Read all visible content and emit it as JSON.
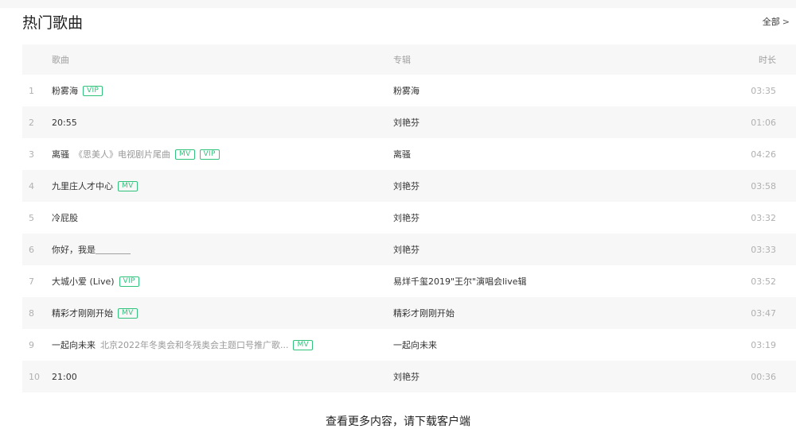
{
  "header": {
    "title": "热门歌曲",
    "more_label": "全部",
    "more_icon": "chevron-right-icon"
  },
  "columns": {
    "song": "歌曲",
    "album": "专辑",
    "duration": "时长"
  },
  "rows": [
    {
      "index": "1",
      "title": "粉雾海",
      "subtitle": "",
      "tags": [
        "VIP"
      ],
      "album": "粉雾海",
      "duration": "03:35"
    },
    {
      "index": "2",
      "title": "20:55",
      "subtitle": "",
      "tags": [],
      "album": "刘艳芬",
      "duration": "01:06"
    },
    {
      "index": "3",
      "title": "离骚",
      "subtitle": "《思美人》电视剧片尾曲",
      "tags": [
        "MV",
        "VIP"
      ],
      "album": "离骚",
      "duration": "04:26"
    },
    {
      "index": "4",
      "title": "九里庄人才中心",
      "subtitle": "",
      "tags": [
        "MV"
      ],
      "album": "刘艳芬",
      "duration": "03:58"
    },
    {
      "index": "5",
      "title": "冷屁股",
      "subtitle": "",
      "tags": [],
      "album": "刘艳芬",
      "duration": "03:32"
    },
    {
      "index": "6",
      "title": "你好，我是＿＿＿＿",
      "subtitle": "",
      "tags": [],
      "album": "刘艳芬",
      "duration": "03:33"
    },
    {
      "index": "7",
      "title": "大城小爱 (Live)",
      "subtitle": "",
      "tags": [
        "VIP"
      ],
      "album": "易烊千玺2019\"王尔\"演唱会live辑",
      "duration": "03:52"
    },
    {
      "index": "8",
      "title": "精彩才刚刚开始",
      "subtitle": "",
      "tags": [
        "MV"
      ],
      "album": "精彩才刚刚开始",
      "duration": "03:47"
    },
    {
      "index": "9",
      "title": "一起向未来",
      "subtitle": "北京2022年冬奥会和冬残奥会主题口号推广歌...",
      "tags": [
        "MV"
      ],
      "album": "一起向未来",
      "duration": "03:19"
    },
    {
      "index": "10",
      "title": "21:00",
      "subtitle": "",
      "tags": [],
      "album": "刘艳芬",
      "duration": "00:36"
    }
  ],
  "footer": {
    "text": "查看更多内容，请下载客户端"
  },
  "colors": {
    "accent": "#31c27c",
    "row_alt": "#f7f7f7",
    "muted": "#b0b0b0"
  }
}
